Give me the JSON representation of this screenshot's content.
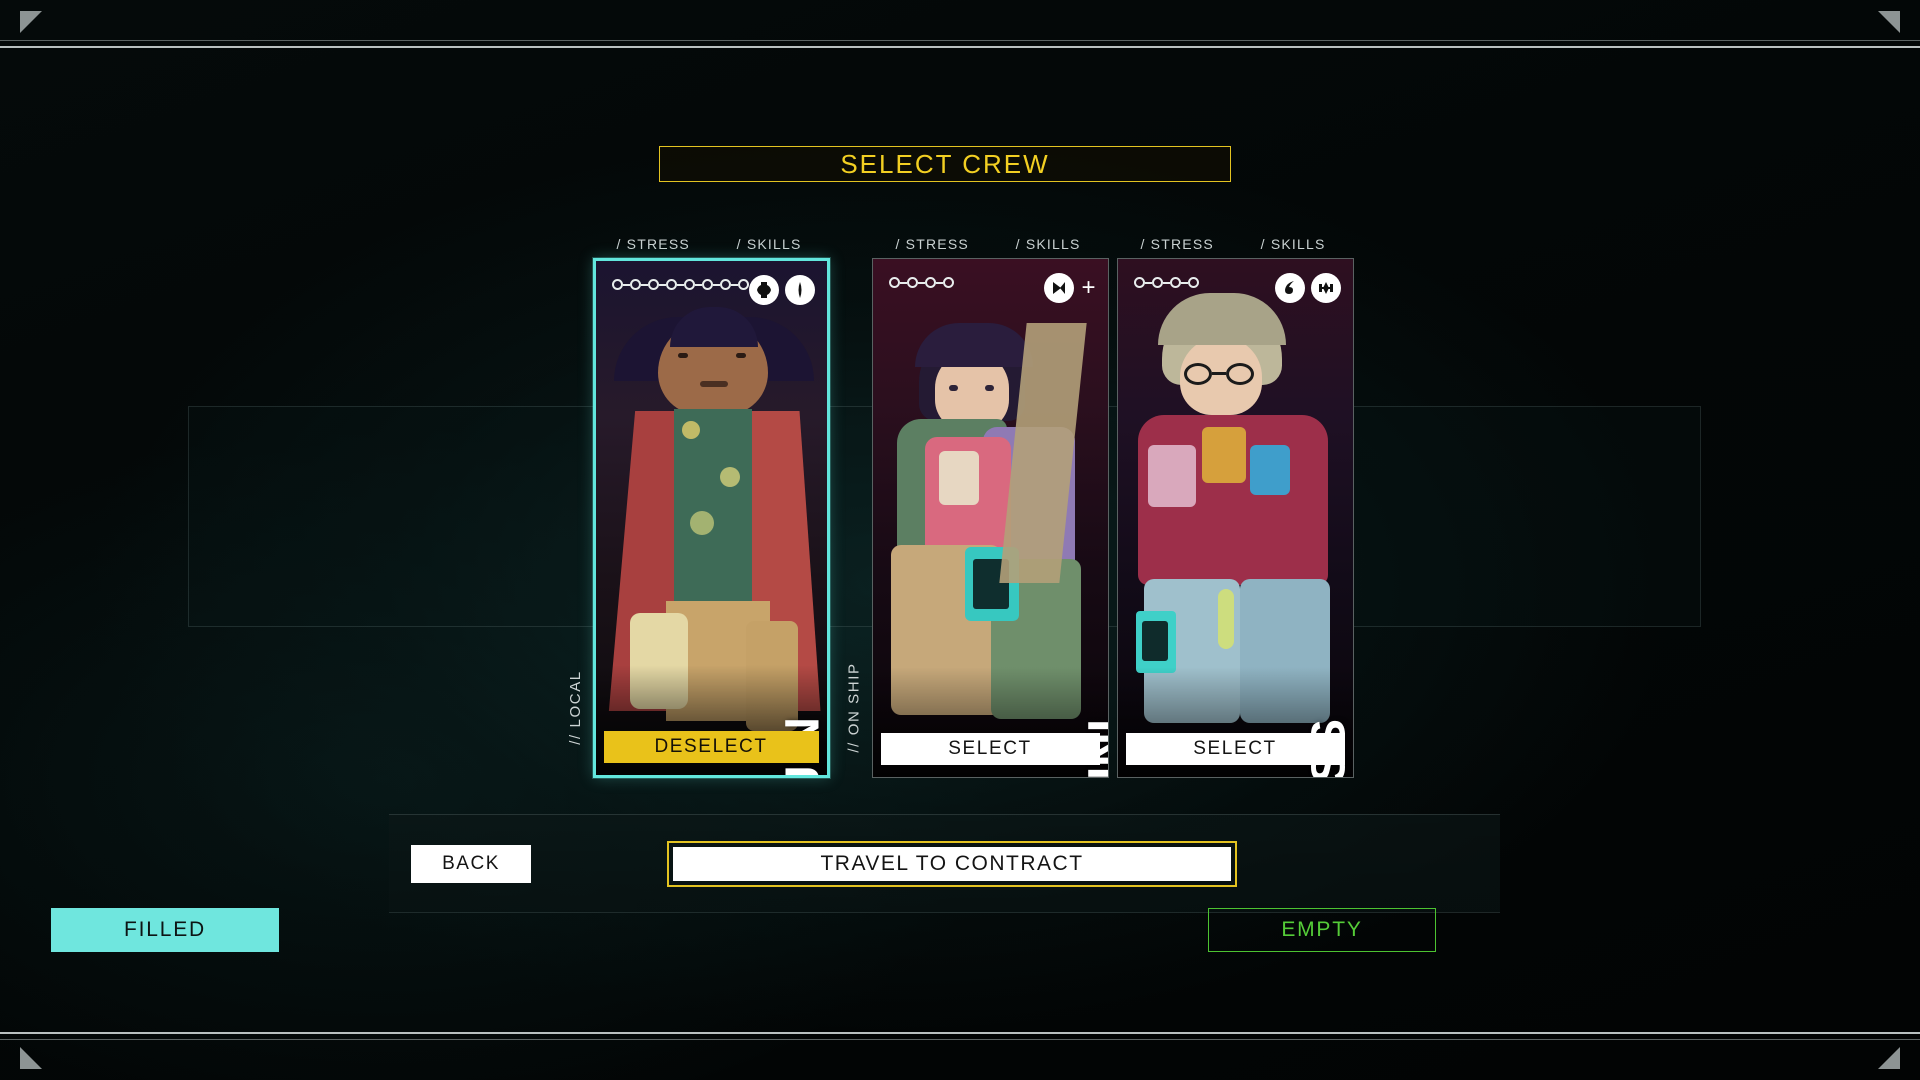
{
  "screen": {
    "title": "SELECT CREW",
    "accent_yellow": "#f2cf22",
    "accent_cyan": "#62e6dd",
    "accent_green": "#55cc38"
  },
  "groups": [
    {
      "label": "// LOCAL"
    },
    {
      "label": "// ON SHIP"
    }
  ],
  "card_headers": {
    "stress": "/ STRESS",
    "skills": "/ SKILLS"
  },
  "crew": [
    {
      "name": "YU-JIN",
      "group": "// LOCAL",
      "stress_pips": 8,
      "skills": [
        "cross-shield-icon",
        "diamond-icon"
      ],
      "skills_overflow": false,
      "selected": true,
      "action_label": "DESELECT"
    },
    {
      "name": "JUNI",
      "group": "// ON SHIP",
      "stress_pips": 4,
      "skills": [
        "play-triangle-icon"
      ],
      "skills_overflow": true,
      "overflow_label": "+",
      "selected": false,
      "action_label": "SELECT"
    },
    {
      "name": "BLISS",
      "group": "// ON SHIP",
      "stress_pips": 4,
      "skills": [
        "droplet-icon",
        "dumbbell-icon"
      ],
      "skills_overflow": false,
      "selected": false,
      "action_label": "SELECT"
    }
  ],
  "bottom_bar": {
    "back_label": "BACK",
    "travel_label": "TRAVEL TO CONTRACT"
  },
  "status": {
    "filled_label": "FILLED",
    "empty_label": "EMPTY"
  }
}
